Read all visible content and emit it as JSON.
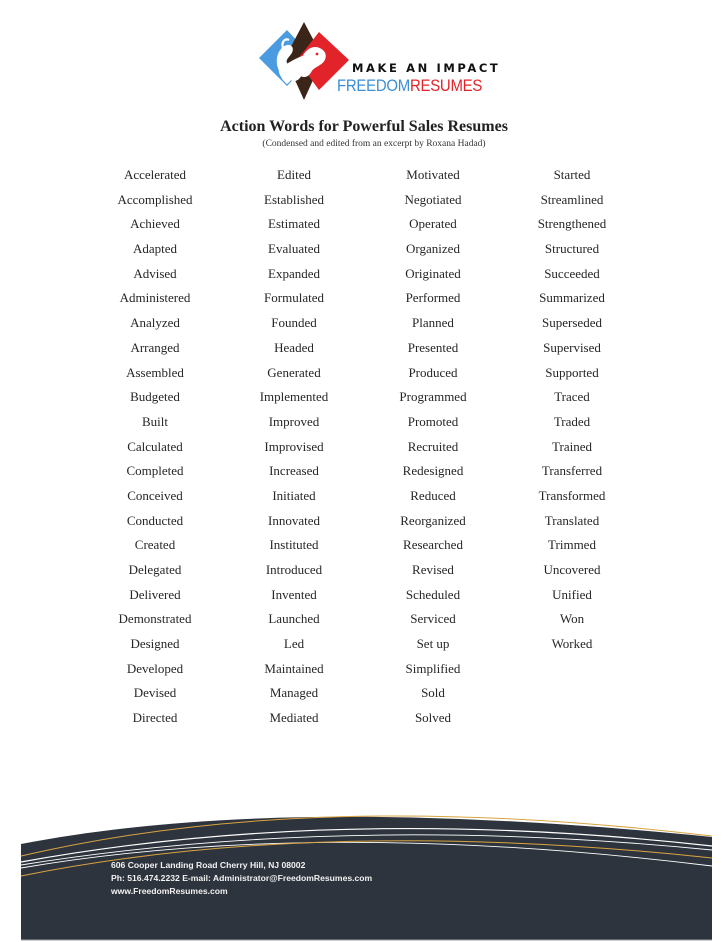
{
  "logo": {
    "icon": "lion-diamond-icon",
    "tagline": "MAKE AN IMPACT",
    "brand_part1": "FREEDOM",
    "brand_part2": "RESUMES",
    "colors": {
      "blue": "#3a8fd6",
      "brown": "#3b2418",
      "red": "#e2232a"
    }
  },
  "document": {
    "title": "Action Words for Powerful Sales Resumes",
    "subtitle": "(Condensed and edited from an excerpt by Roxana Hadad)"
  },
  "words": {
    "columns": [
      [
        "Accelerated",
        "Accomplished",
        "Achieved",
        "Adapted",
        "Advised",
        "Administered",
        "Analyzed",
        "Arranged",
        "Assembled",
        "Budgeted",
        "Built",
        "Calculated",
        "Completed",
        "Conceived",
        "Conducted",
        "Created",
        "Delegated",
        "Delivered",
        "Demonstrated",
        "Designed",
        "Developed",
        "Devised",
        "Directed"
      ],
      [
        "Edited",
        "Established",
        "Estimated",
        "Evaluated",
        "Expanded",
        "Formulated",
        "Founded",
        "Headed",
        "Generated",
        "Implemented",
        "Improved",
        "Improvised",
        "Increased",
        "Initiated",
        "Innovated",
        "Instituted",
        "Introduced",
        "Invented",
        "Launched",
        "Led",
        "Maintained",
        "Managed",
        "Mediated"
      ],
      [
        "Motivated",
        "Negotiated",
        "Operated",
        "Organized",
        "Originated",
        "Performed",
        "Planned",
        "Presented",
        "Produced",
        "Programmed",
        "Promoted",
        "Recruited",
        "Redesigned",
        "Reduced",
        "Reorganized",
        "Researched",
        "Revised",
        "Scheduled",
        "Serviced",
        "Set up",
        "Simplified",
        "Sold",
        "Solved"
      ],
      [
        "Started",
        "Streamlined",
        "Strengthened",
        "Structured",
        "Succeeded",
        "Summarized",
        "Superseded",
        "Supervised",
        "Supported",
        "Traced",
        "Traded",
        "Trained",
        "Transferred",
        "Transformed",
        "Translated",
        "Trimmed",
        "Uncovered",
        "Unified",
        "Won",
        "Worked"
      ]
    ]
  },
  "footer": {
    "address": "606 Cooper Landing Road Cherry Hill, NJ 08002",
    "contact": "Ph: 516.474.2232 E-mail: Administrator@FreedomResumes.com",
    "website": "www.FreedomResumes.com",
    "colors": {
      "band": "#2e343d",
      "accent_gold": "#d9a441",
      "accent_white": "#ffffff"
    }
  }
}
